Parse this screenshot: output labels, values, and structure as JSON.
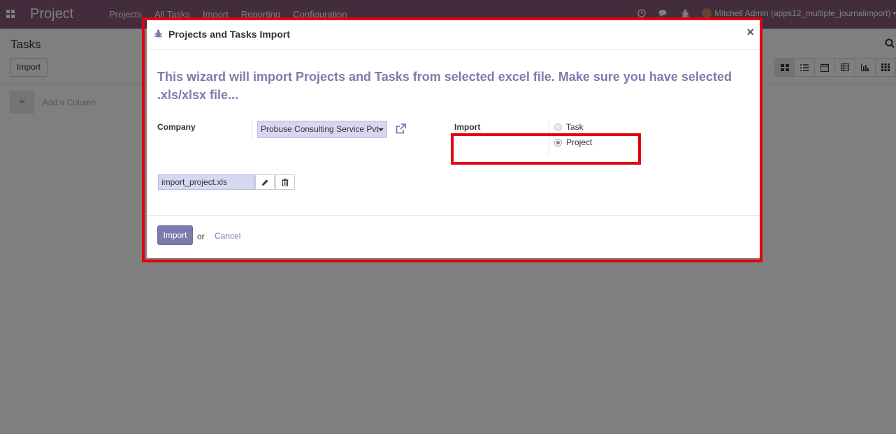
{
  "topbar": {
    "app_title": "Project",
    "menu": [
      "Projects",
      "All Tasks",
      "Import",
      "Reporting",
      "Configuration"
    ],
    "systray_icons": [
      "clock-icon",
      "chat-icon",
      "bug-icon"
    ],
    "user": "Mitchell Admin (apps12_multiple_journalimport)"
  },
  "control_panel": {
    "title": "Tasks",
    "import_button": "Import",
    "views": [
      "kanban-view",
      "list-view",
      "calendar-view",
      "pivot-view",
      "graph-view",
      "grid-view"
    ],
    "active_view": "kanban-view"
  },
  "kanban": {
    "add_symbol": "+",
    "add_column_label": "Add a Column"
  },
  "dialog": {
    "title": "Projects and Tasks Import",
    "close_symbol": "×",
    "description": "This wizard will import Projects and Tasks from selected excel file. Make sure you have selected .xls/xlsx file...",
    "company_label": "Company",
    "company_value": "Probuse Consulting Service Pvt",
    "import_label": "Import",
    "import_options": [
      {
        "label": "Task",
        "checked": false
      },
      {
        "label": "Project",
        "checked": true
      }
    ],
    "file_name": "import_project.xls",
    "import_button": "Import",
    "or_text": "or",
    "cancel_label": "Cancel"
  },
  "colors": {
    "brand": "#875a7b",
    "accent": "#7c7bad",
    "annotation": "#e3000f"
  }
}
